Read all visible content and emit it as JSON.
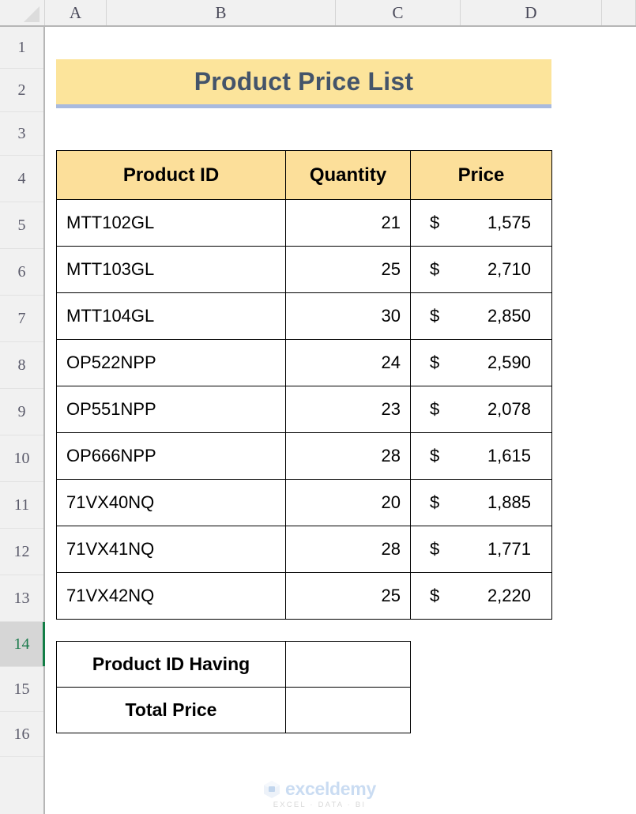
{
  "spreadsheet": {
    "column_headers": [
      "A",
      "B",
      "C",
      "D"
    ],
    "row_headers": [
      "1",
      "2",
      "3",
      "4",
      "5",
      "6",
      "7",
      "8",
      "9",
      "10",
      "11",
      "12",
      "13",
      "14",
      "15",
      "16"
    ],
    "active_row": "14",
    "gridlines_visible": false
  },
  "title": {
    "text": "Product Price List",
    "fill_color": "#fce49b",
    "text_color": "#44546a",
    "underline_color": "#a8bade"
  },
  "table": {
    "headers": [
      "Product ID",
      "Quantity",
      "Price"
    ],
    "header_fill": "#fcdf9a",
    "rows": [
      {
        "product_id": "MTT102GL",
        "quantity": "21",
        "currency": "$",
        "price": "1,575"
      },
      {
        "product_id": "MTT103GL",
        "quantity": "25",
        "currency": "$",
        "price": "2,710"
      },
      {
        "product_id": "MTT104GL",
        "quantity": "30",
        "currency": "$",
        "price": "2,850"
      },
      {
        "product_id": "OP522NPP",
        "quantity": "24",
        "currency": "$",
        "price": "2,590"
      },
      {
        "product_id": "OP551NPP",
        "quantity": "23",
        "currency": "$",
        "price": "2,078"
      },
      {
        "product_id": "OP666NPP",
        "quantity": "28",
        "currency": "$",
        "price": "1,615"
      },
      {
        "product_id": "71VX40NQ",
        "quantity": "20",
        "currency": "$",
        "price": "1,885"
      },
      {
        "product_id": "71VX41NQ",
        "quantity": "28",
        "currency": "$",
        "price": "1,771"
      },
      {
        "product_id": "71VX42NQ",
        "quantity": "25",
        "currency": "$",
        "price": "2,220"
      }
    ]
  },
  "summary": {
    "rows": [
      {
        "label": "Product ID Having",
        "value": ""
      },
      {
        "label": "Total Price",
        "value": ""
      }
    ]
  },
  "watermark": {
    "name": "exceldemy",
    "tagline": "EXCEL  ·  DATA  ·  BI",
    "logo_icon": "hexagon-logo-icon"
  }
}
